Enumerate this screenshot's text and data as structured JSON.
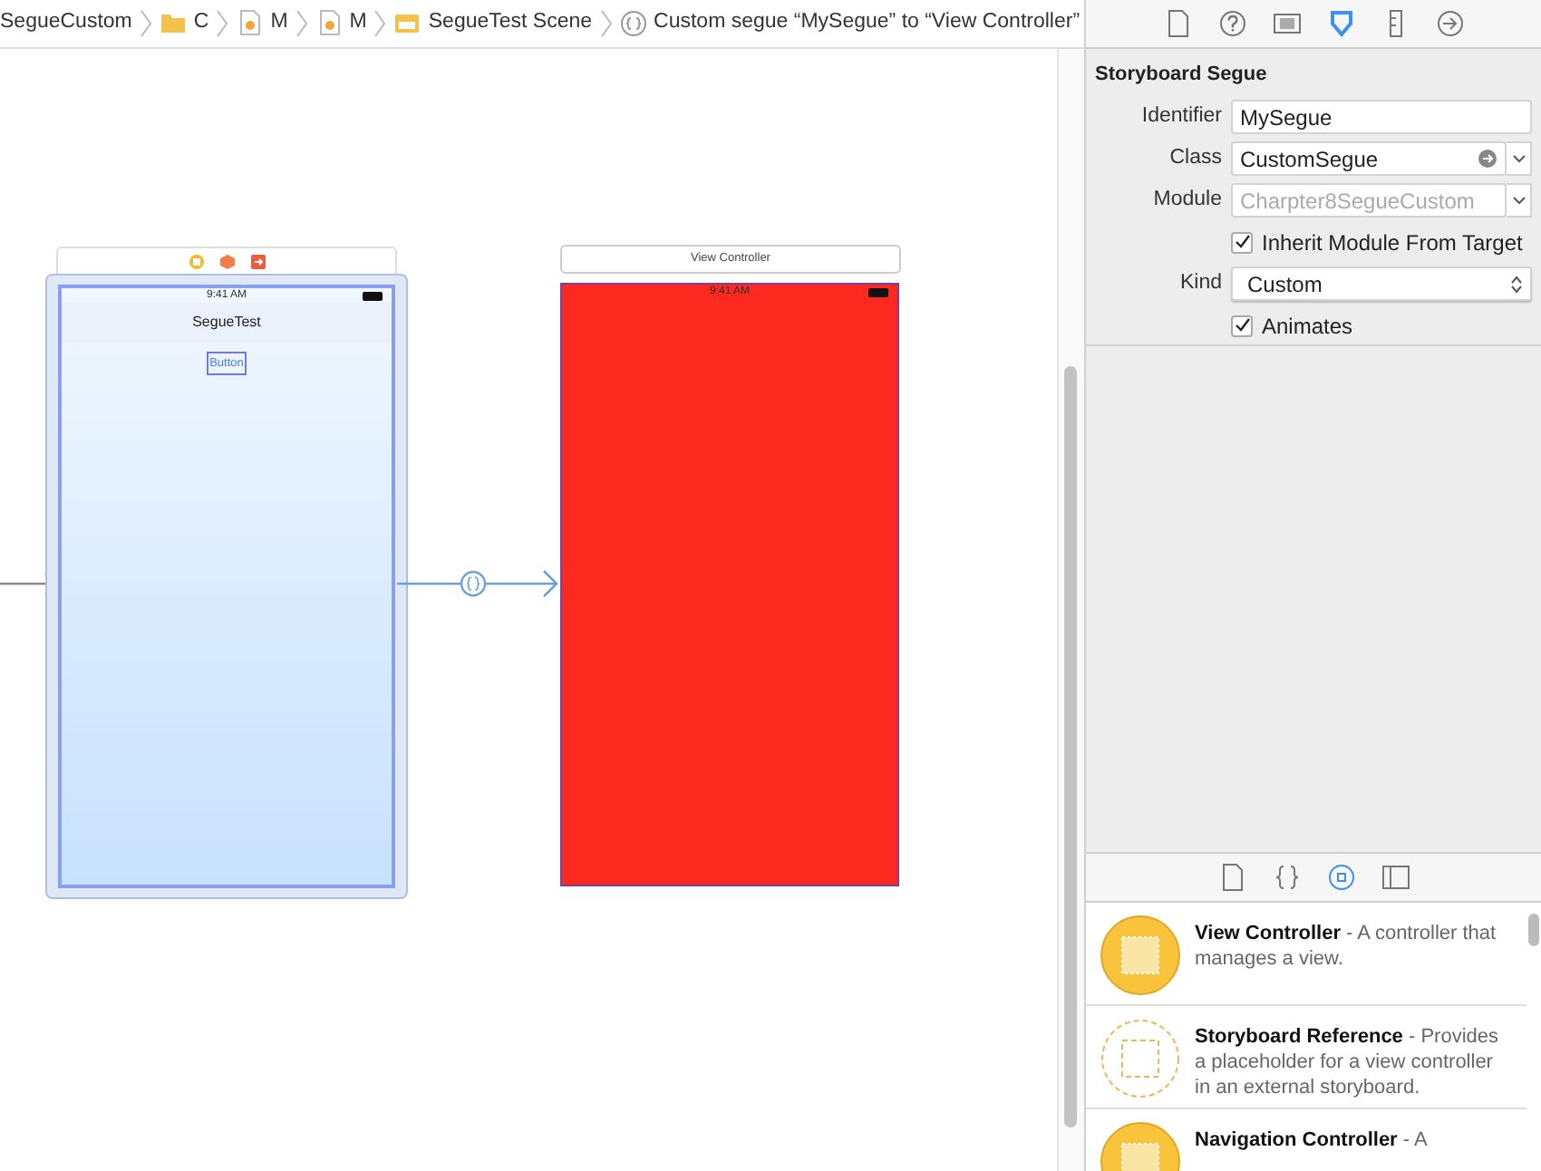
{
  "breadcrumb": [
    {
      "text": "SegueCustom",
      "kind": "project"
    },
    {
      "text": "C",
      "kind": "folder"
    },
    {
      "text": "M",
      "kind": "file"
    },
    {
      "text": "M",
      "kind": "file"
    },
    {
      "text": "SegueTest Scene",
      "kind": "scene"
    },
    {
      "text": "Custom segue “MySegue” to “View Controller”",
      "kind": "segue"
    }
  ],
  "canvas": {
    "scenes": [
      {
        "kind": "dock",
        "selected": true,
        "status_time": "9:41 AM",
        "nav_title": "SegueTest",
        "button": "Button"
      },
      {
        "kind": "header",
        "header": "View Controller",
        "status_time": "9:41 AM",
        "color": "#fc2a1e"
      }
    ]
  },
  "inspector": {
    "tabs": [
      {
        "kind": "file",
        "selected": false
      },
      {
        "kind": "help",
        "selected": false
      },
      {
        "kind": "identity",
        "selected": false
      },
      {
        "kind": "attributes",
        "selected": true
      },
      {
        "kind": "size",
        "selected": false
      },
      {
        "kind": "connections",
        "selected": false
      }
    ],
    "section_title": "Storyboard Segue",
    "rows": [
      {
        "kind": "text",
        "label": "Identifier",
        "value": "MySegue"
      },
      {
        "kind": "combo",
        "label": "Class",
        "value": "CustomSegue"
      },
      {
        "kind": "combo-placeholder",
        "label": "Module",
        "placeholder": "Charpter8SegueCustom"
      },
      {
        "kind": "check",
        "label": "Inherit Module From Target",
        "checked": true
      },
      {
        "kind": "select",
        "label": "Kind",
        "value": "Custom"
      },
      {
        "kind": "check",
        "label": "Animates",
        "checked": true
      }
    ]
  },
  "library": {
    "tabs": [
      {
        "kind": "file",
        "selected": false
      },
      {
        "kind": "code",
        "selected": false
      },
      {
        "kind": "object",
        "selected": true
      },
      {
        "kind": "media",
        "selected": false
      }
    ],
    "items": [
      {
        "kind": "solid",
        "title": "View Controller",
        "description": "- A controller that manages a view."
      },
      {
        "kind": "dashed",
        "title": "Storyboard Reference",
        "description": "- Provides a placeholder for a view controller in an external storyboard."
      },
      {
        "kind": "solid",
        "title": "Navigation Controller",
        "description": "- A"
      }
    ]
  }
}
